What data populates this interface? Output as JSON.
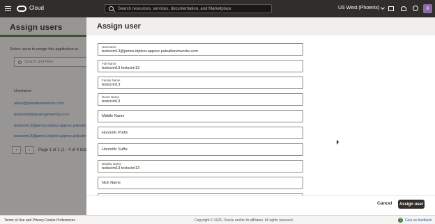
{
  "topbar": {
    "brand": "Cloud",
    "search_placeholder": "Search resources, services, documentation, and Marketplace",
    "region": "US West (Phoenix)",
    "avatar": "X"
  },
  "background_page": {
    "title": "Assign users",
    "hint": "Select users to assign this application to.",
    "search_placeholder": "Search and Filter",
    "column_header": "Username",
    "rows": [
      "aisko@paloaltonetworks.com",
      "testscim9@arpiengineering.com",
      "testscim13@james.idptest.appsvc.paloalto",
      "testscim14@james.idptest.appsvc.paloalto"
    ],
    "pager_text": "Page 1 of 1 (1 - 4 of 4 total)",
    "pager_prev": "‹",
    "pager_next": "›"
  },
  "drawer": {
    "title": "Assign user",
    "fields": [
      {
        "label": "Username",
        "value": "testscim13@james.idptest.appsvc.paloaltonetworks.com"
      },
      {
        "label": "Full Name",
        "value": "testscim13 testscim13"
      },
      {
        "label": "Family Name",
        "value": "testscim13"
      },
      {
        "label": "Given Name",
        "value": "testscim13"
      },
      {
        "label": "Middle Name",
        "value": ""
      },
      {
        "label": "Honorific Prefix",
        "value": ""
      },
      {
        "label": "Honorific Suffix",
        "value": ""
      },
      {
        "label": "Display Name",
        "value": "testscim13 testscim13"
      },
      {
        "label": "Nick Name",
        "value": ""
      },
      {
        "label": "",
        "value": ""
      }
    ],
    "cancel_label": "Cancel",
    "assign_label": "Assign user"
  },
  "footer": {
    "terms": "Terms of Use and Privacy",
    "cookies": "Cookie Preferences",
    "copyright": "Copyright © 2026, Oracle and/or its affiliates. All rights reserved.",
    "feedback": "Give us feedback"
  }
}
